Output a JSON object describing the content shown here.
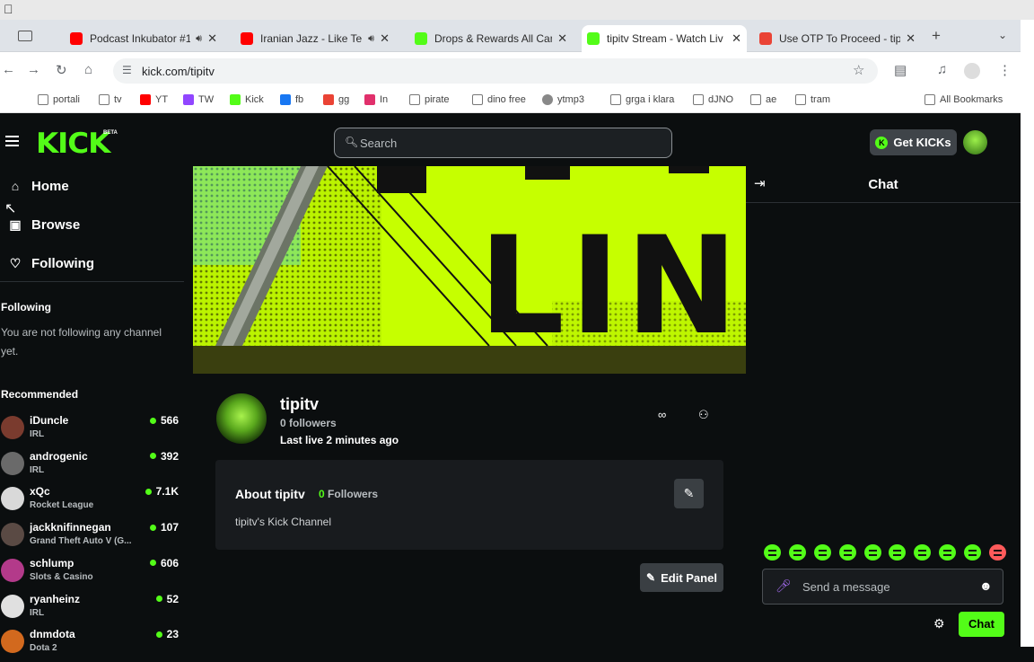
{
  "browser": {
    "tabs": [
      {
        "title": "Podcast Inkubator #1",
        "icon_color": "#ff0000",
        "audio": true
      },
      {
        "title": "Iranian Jazz - Like Te",
        "icon_color": "#ff0000",
        "audio": true
      },
      {
        "title": "Drops & Rewards All Can",
        "icon_color": "#53fc18",
        "audio": false
      },
      {
        "title": "tipitv Stream - Watch Liv",
        "icon_color": "#53fc18",
        "audio": false,
        "active": true
      },
      {
        "title": "Use OTP To Proceed - tip",
        "icon_color": "#ea4335",
        "audio": false
      }
    ],
    "url": "kick.com/tipitv",
    "bookmarks": [
      {
        "label": "portali",
        "type": "folder"
      },
      {
        "label": "tv",
        "type": "folder"
      },
      {
        "label": "YT",
        "type": "youtube",
        "color": "#ff0000"
      },
      {
        "label": "TW",
        "type": "twitch",
        "color": "#9146ff"
      },
      {
        "label": "Kick",
        "type": "kick",
        "color": "#53fc18"
      },
      {
        "label": "fb",
        "type": "facebook",
        "color": "#1877f2"
      },
      {
        "label": "gg",
        "type": "gmail",
        "color": "#ea4335"
      },
      {
        "label": "In",
        "type": "instagram",
        "color": "#e1306c"
      },
      {
        "label": "pirate",
        "type": "folder"
      },
      {
        "label": "dino free",
        "type": "folder"
      },
      {
        "label": "ytmp3",
        "type": "globe"
      },
      {
        "label": "grga i klara",
        "type": "folder"
      },
      {
        "label": "dJNO",
        "type": "folder"
      },
      {
        "label": "ae",
        "type": "folder"
      },
      {
        "label": "tram",
        "type": "folder"
      }
    ],
    "all_bookmarks": "All Bookmarks"
  },
  "header": {
    "logo": "KICK",
    "beta": "BETA",
    "search_placeholder": "Search",
    "get_kicks": "Get KICKs"
  },
  "sidebar": {
    "nav": [
      {
        "label": "Home",
        "icon": "home-icon"
      },
      {
        "label": "Browse",
        "icon": "browse-icon"
      },
      {
        "label": "Following",
        "icon": "heart-icon"
      }
    ],
    "following_heading": "Following",
    "following_empty": "You are not following any channel yet.",
    "recommended_heading": "Recommended",
    "recommended": [
      {
        "name": "iDuncle",
        "category": "IRL",
        "viewers": "566",
        "avatar_color": "#7a3b2e"
      },
      {
        "name": "androgenic",
        "category": "IRL",
        "viewers": "392",
        "avatar_color": "#6a6a6a"
      },
      {
        "name": "xQc",
        "category": "Rocket League",
        "viewers": "7.1K",
        "avatar_color": "#d9d9d9"
      },
      {
        "name": "jackknifinnegan",
        "category": "Grand Theft Auto V (G...",
        "viewers": "107",
        "avatar_color": "#5a4a44"
      },
      {
        "name": "schlump",
        "category": "Slots & Casino",
        "viewers": "606",
        "avatar_color": "#b33a8a"
      },
      {
        "name": "ryanheinz",
        "category": "IRL",
        "viewers": "52",
        "avatar_color": "#e0e0e0"
      },
      {
        "name": "dnmdota",
        "category": "Dota 2",
        "viewers": "23",
        "avatar_color": "#d2691e"
      }
    ]
  },
  "banner": {
    "text": "LINE",
    "colors": {
      "lime": "#c6ff00",
      "dark": "#1a1a1a"
    }
  },
  "channel": {
    "name": "tipitv",
    "followers": "0 followers",
    "last_live": "Last live 2 minutes ago"
  },
  "about": {
    "title": "About tipitv",
    "followers_count": "0",
    "followers_label": "Followers",
    "description": "tipitv's Kick Channel",
    "edit_panel": "Edit Panel"
  },
  "chat": {
    "title": "Chat",
    "placeholder": "Send a message",
    "send": "Chat"
  },
  "colors": {
    "accent": "#53fc18",
    "bg": "#0b0e0f",
    "panel": "#181b1e"
  }
}
